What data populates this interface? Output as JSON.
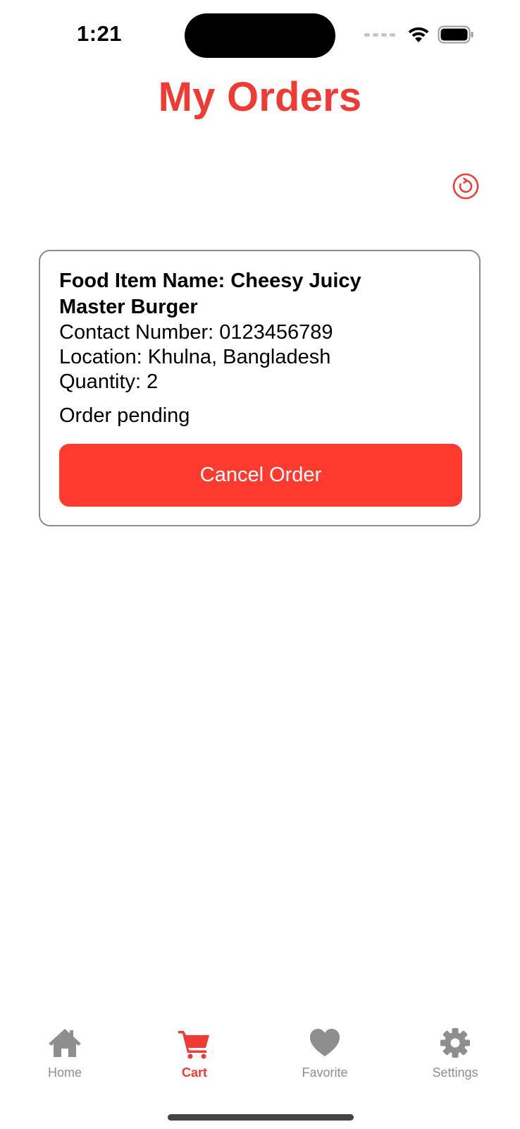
{
  "status_bar": {
    "time": "1:21"
  },
  "header": {
    "title": "My Orders"
  },
  "toolbar": {
    "refresh_icon": "refresh-icon"
  },
  "order": {
    "food_item": "Food Item Name: Cheesy Juicy Master Burger",
    "contact": "Contact Number: 0123456789",
    "location": "Location: Khulna, Bangladesh",
    "quantity": "Quantity: 2",
    "status": "Order pending",
    "cancel_label": "Cancel Order"
  },
  "tabs": [
    {
      "label": "Home",
      "icon": "home-icon",
      "active": false
    },
    {
      "label": "Cart",
      "icon": "cart-icon",
      "active": true
    },
    {
      "label": "Favorite",
      "icon": "heart-icon",
      "active": false
    },
    {
      "label": "Settings",
      "icon": "gear-icon",
      "active": false
    }
  ],
  "colors": {
    "accent": "#ef3b33",
    "button": "#ff3b30",
    "tab_inactive": "#8e8e8e",
    "card_border": "#8c8c8c"
  }
}
